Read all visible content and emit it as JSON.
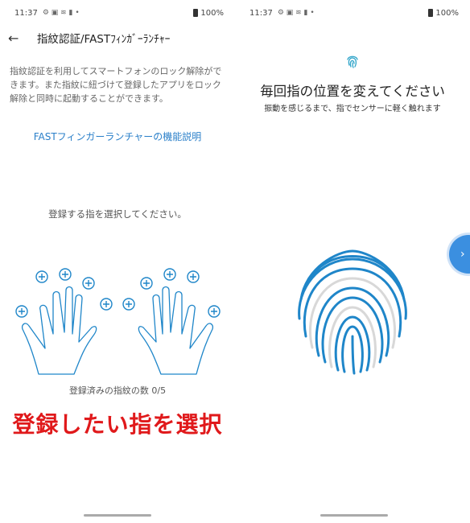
{
  "left": {
    "status": {
      "time": "11:37",
      "icons": "⚙ ▣ ≋ ▮ •",
      "battery": "100%"
    },
    "header": {
      "title": "指紋認証/FASTﾌｨﾝｶﾞｰﾗﾝﾁｬｰ"
    },
    "description": "指紋認証を利用してスマートフォンのロック解除ができます。また指紋に紐づけて登録したアプリをロック解除と同時に起動することができます。",
    "link": "FASTフィンガーランチャーの機能説明",
    "prompt": "登録する指を選択してください。",
    "finger_count": "登録済みの指紋の数 0/5",
    "overlay_caption": "登録したい指を選択"
  },
  "right": {
    "status": {
      "time": "11:37",
      "icons": "⚙ ▣ ≋ ▮ •",
      "battery": "100%"
    },
    "title": "毎回指の位置を変えてください",
    "subtitle": "振動を感じるまで、指でセンサーに軽く触れます"
  },
  "colors": {
    "accent": "#2a7fc9",
    "overlay": "#e0191b",
    "fingerprint_blue": "#1f86c9",
    "fingerprint_gray": "#d8d8d8"
  },
  "icons": {
    "back": "arrow-left-icon",
    "add": "plus-circle-icon",
    "fingerprint": "fingerprint-icon",
    "next": "chevron-right-icon"
  }
}
